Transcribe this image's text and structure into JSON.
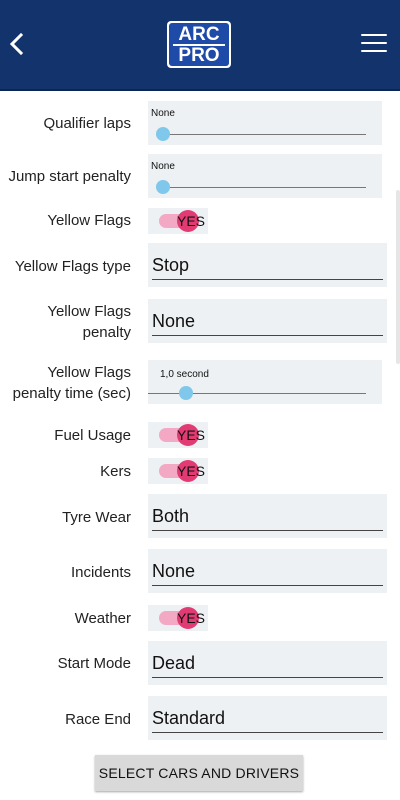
{
  "header": {
    "logo_line1": "ARC",
    "logo_line2": "PRO"
  },
  "settings": {
    "qualifier_laps": {
      "label": "Qualifier laps",
      "value": "None"
    },
    "jump_start_penalty": {
      "label": "Jump start penalty",
      "value": "None"
    },
    "yellow_flags": {
      "label": "Yellow Flags",
      "value": "YES"
    },
    "yellow_flags_type": {
      "label": "Yellow Flags type",
      "value": "Stop"
    },
    "yellow_flags_penalty": {
      "label_line1": "Yellow Flags",
      "label_line2": "penalty",
      "value": "None"
    },
    "yellow_flags_penalty_time": {
      "label_line1": "Yellow Flags",
      "label_line2": "penalty time (sec)",
      "value": "1,0 second"
    },
    "fuel_usage": {
      "label": "Fuel Usage",
      "value": "YES"
    },
    "kers": {
      "label": "Kers",
      "value": "YES"
    },
    "tyre_wear": {
      "label": "Tyre Wear",
      "value": "Both"
    },
    "incidents": {
      "label": "Incidents",
      "value": "None"
    },
    "weather": {
      "label": "Weather",
      "value": "YES"
    },
    "start_mode": {
      "label": "Start Mode",
      "value": "Dead"
    },
    "race_end": {
      "label": "Race End",
      "value": "Standard"
    }
  },
  "footer": {
    "select_button": "SELECT CARS AND DRIVERS"
  },
  "icons": {
    "back": "chevron-left-icon",
    "menu": "hamburger-menu-icon"
  },
  "colors": {
    "header_bg": "#13336d",
    "logo_bg": "#1e4aa8",
    "toggle_on": "#e23b74",
    "slider_thumb": "#7fc8ec",
    "field_bg": "#edf1f3"
  }
}
